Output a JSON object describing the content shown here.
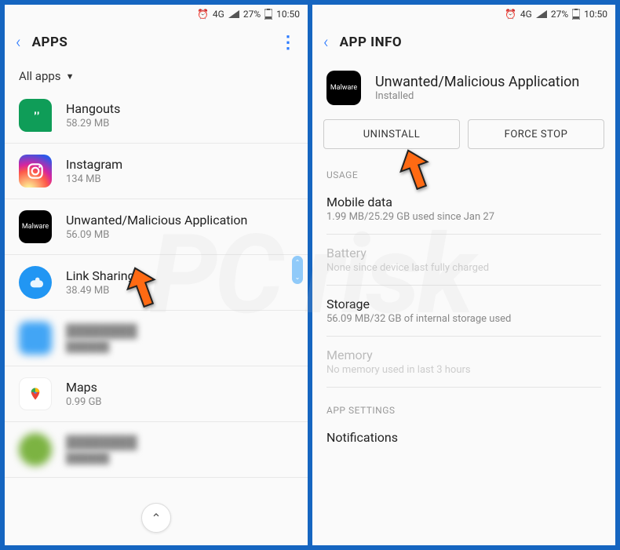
{
  "status": {
    "network": "4G",
    "battery_pct": "27%",
    "time": "10:50"
  },
  "left": {
    "title": "APPS",
    "filter": "All apps",
    "apps": [
      {
        "name": "Hangouts",
        "sub": "58.29 MB"
      },
      {
        "name": "Instagram",
        "sub": "134 MB"
      },
      {
        "name": "Unwanted/Malicious Application",
        "sub": "56.09 MB",
        "icon_label": "Malware"
      },
      {
        "name": "Link Sharing",
        "sub": "38.49 MB"
      },
      {
        "name": "",
        "sub": ""
      },
      {
        "name": "Maps",
        "sub": "0.99 GB"
      },
      {
        "name": "",
        "sub": ""
      }
    ]
  },
  "right": {
    "title": "APP INFO",
    "app_name": "Unwanted/Malicious Application",
    "app_status": "Installed",
    "icon_label": "Malware",
    "buttons": {
      "uninstall": "UNINSTALL",
      "force_stop": "FORCE STOP"
    },
    "sections": {
      "usage": "USAGE",
      "mobile_data": {
        "label": "Mobile data",
        "val": "1.99 MB/25.29 GB used since Jan 27"
      },
      "battery": {
        "label": "Battery",
        "val": "None since device last fully charged"
      },
      "storage": {
        "label": "Storage",
        "val": "56.09 MB/32 GB of internal storage used"
      },
      "memory": {
        "label": "Memory",
        "val": "No memory used in last 3 hours"
      },
      "app_settings": "APP SETTINGS",
      "notifications": "Notifications"
    }
  }
}
